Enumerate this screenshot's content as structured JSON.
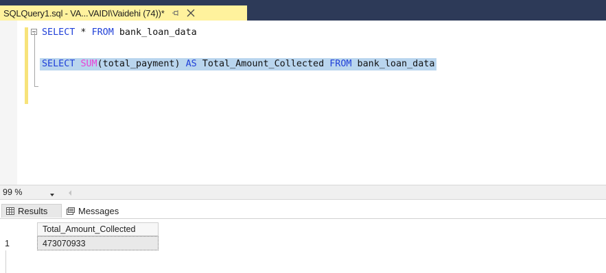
{
  "tab": {
    "title": "SQLQuery1.sql - VA...VAIDI\\Vaidehi (74))*",
    "pin_icon": "pin-icon",
    "close_icon": "close-icon"
  },
  "editor": {
    "line1": {
      "kw1": "SELECT",
      "rest1": " * ",
      "kw2": "FROM",
      "rest2": " bank_loan_data"
    },
    "line2": {
      "kw1": "SELECT",
      "sp1": " ",
      "fn": "SUM",
      "args": "(total_payment) ",
      "kw2": "AS",
      "alias": " Total_Amount_Collected ",
      "kw3": "FROM",
      "table": " bank_loan_data"
    },
    "colors": {
      "keyword": "#1f3fd8",
      "function": "#ea41d6",
      "selection": "#b9d5ee",
      "tab_background": "#fff29d",
      "tabstrip_background": "#2d3a58"
    }
  },
  "zoom": {
    "value": "99 %"
  },
  "results": {
    "tabs": [
      {
        "label": "Results",
        "icon": "grid-icon"
      },
      {
        "label": "Messages",
        "icon": "messages-icon"
      }
    ],
    "columns": [
      "Total_Amount_Collected"
    ],
    "rows": [
      {
        "num": "1",
        "values": [
          "473070933"
        ]
      }
    ]
  }
}
